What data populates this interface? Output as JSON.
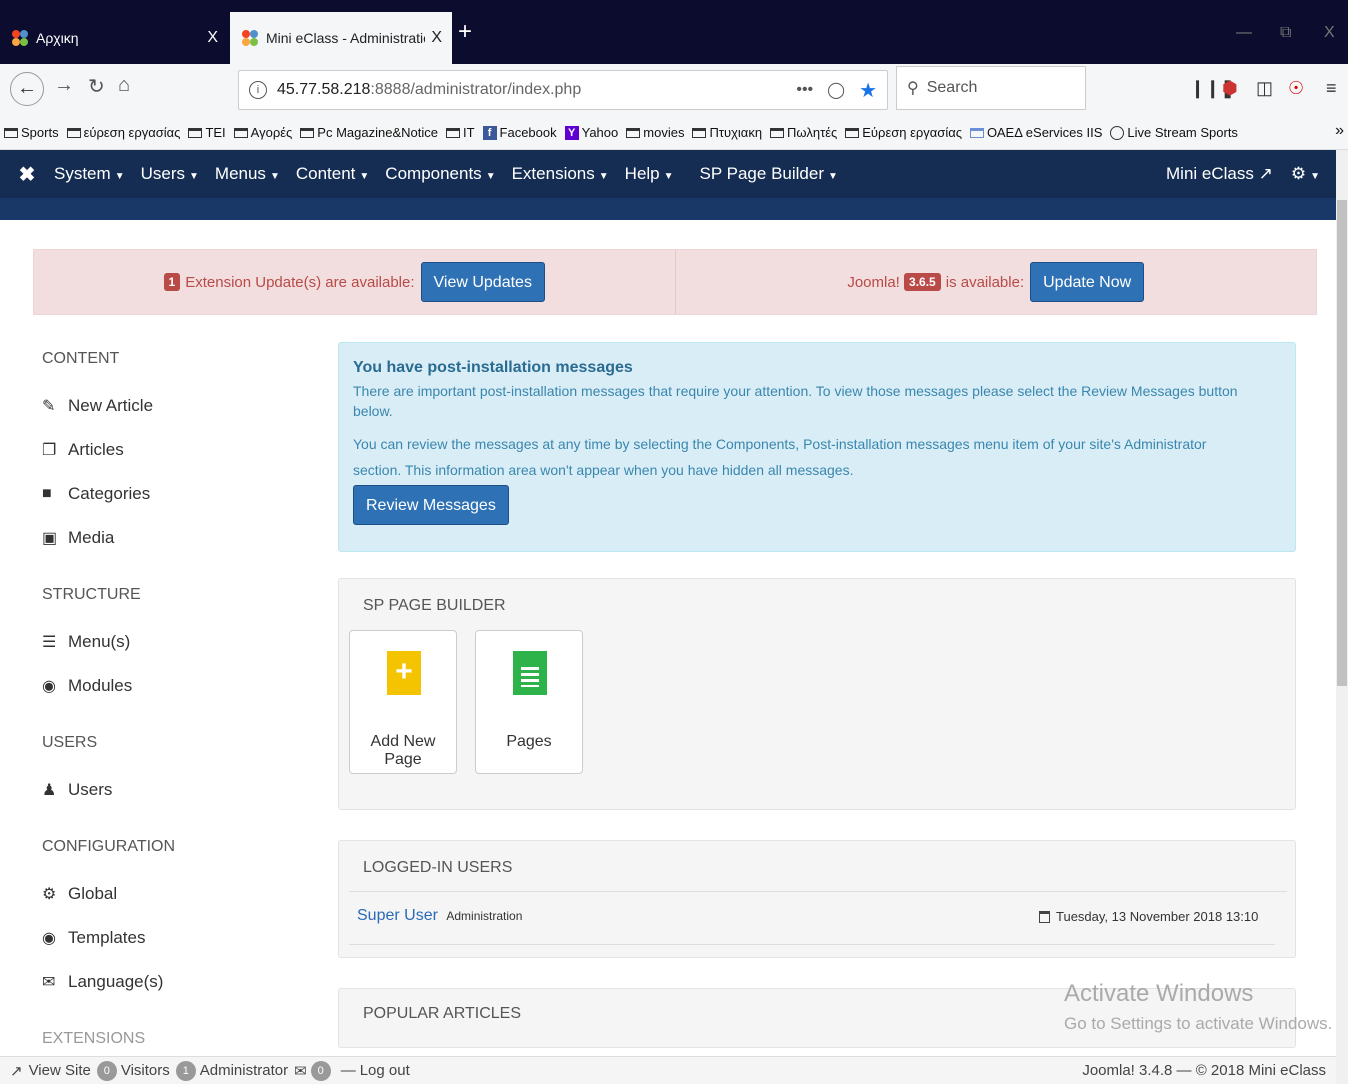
{
  "browser": {
    "tabs": [
      {
        "title": "Αρχικη",
        "close": "X"
      },
      {
        "title": "Mini eClass - Administration - ",
        "close": "X"
      }
    ],
    "new_tab": "+",
    "window_controls": {
      "minimize": "—",
      "restore": "⧉",
      "close": "X"
    },
    "url_host": "45.77.58.218",
    "url_rest": ":8888/administrator/index.php",
    "url_more": "•••",
    "search_placeholder": "Search",
    "bookmarks": [
      {
        "label": "Sports",
        "icon": "folder-icon"
      },
      {
        "label": "εύρεση εργασίας",
        "icon": "folder-icon"
      },
      {
        "label": "TEI",
        "icon": "folder-icon"
      },
      {
        "label": "Αγορές",
        "icon": "folder-icon"
      },
      {
        "label": "Pc Magazine&Notice",
        "icon": "folder-icon"
      },
      {
        "label": "IT",
        "icon": "folder-icon"
      },
      {
        "label": "Facebook",
        "icon": "facebook-icon"
      },
      {
        "label": "Yahoo",
        "icon": "yahoo-icon"
      },
      {
        "label": "movies",
        "icon": "folder-icon"
      },
      {
        "label": "Πτυχιακη",
        "icon": "folder-icon"
      },
      {
        "label": "Πωλητές",
        "icon": "folder-icon"
      },
      {
        "label": "Εύρεση εργασίας",
        "icon": "folder-icon"
      },
      {
        "label": "ΟΑΕΔ eServices IIS",
        "icon": "page-icon"
      },
      {
        "label": "Live Stream Sports",
        "icon": "globe-icon"
      }
    ],
    "bookmarks_more": "»"
  },
  "admin_menu": {
    "items": [
      "System",
      "Users",
      "Menus",
      "Content",
      "Components",
      "Extensions",
      "Help",
      "SP Page Builder"
    ],
    "site_name": "Mini eClass"
  },
  "alerts": {
    "ext_count": "1",
    "ext_text": "Extension Update(s) are available:",
    "ext_button": "View Updates",
    "joomla_prefix": "Joomla!",
    "joomla_version": "3.6.5",
    "joomla_suffix": "is available:",
    "joomla_button": "Update Now"
  },
  "sidebar": {
    "sections": [
      {
        "heading": "CONTENT",
        "items": [
          {
            "label": "New Article",
            "icon": "pencil-icon"
          },
          {
            "label": "Articles",
            "icon": "copy-icon"
          },
          {
            "label": "Categories",
            "icon": "folder-icon"
          },
          {
            "label": "Media",
            "icon": "image-icon"
          }
        ]
      },
      {
        "heading": "STRUCTURE",
        "items": [
          {
            "label": "Menu(s)",
            "icon": "list-icon"
          },
          {
            "label": "Modules",
            "icon": "cube-icon"
          }
        ]
      },
      {
        "heading": "USERS",
        "items": [
          {
            "label": "Users",
            "icon": "users-icon"
          }
        ]
      },
      {
        "heading": "CONFIGURATION",
        "items": [
          {
            "label": "Global",
            "icon": "gear-icon"
          },
          {
            "label": "Templates",
            "icon": "eye-icon"
          },
          {
            "label": "Language(s)",
            "icon": "comments-icon"
          }
        ]
      },
      {
        "heading": "EXTENSIONS",
        "items": []
      }
    ]
  },
  "postinstall": {
    "heading": "You have post-installation messages",
    "text1": "There are important post-installation messages that require your attention. To view those messages please select the Review Messages button below.",
    "text2": "You can review the messages at any time by selecting the Components, Post-installation messages menu item of your site's Administrator section. This information area won't appear when you have hidden all messages.",
    "button": "Review Messages"
  },
  "sp_page_builder": {
    "heading": "SP PAGE BUILDER",
    "cards": [
      {
        "label": "Add New Page",
        "icon": "add-page-icon"
      },
      {
        "label": "Pages",
        "icon": "pages-icon"
      }
    ]
  },
  "logged_in": {
    "heading": "LOGGED-IN USERS",
    "user": "Super User",
    "role": "Administration",
    "date": "Tuesday, 13 November 2018 13:10"
  },
  "popular": {
    "heading": "POPULAR ARTICLES"
  },
  "watermark": {
    "line1": "Activate Windows",
    "line2": "Go to Settings to activate Windows."
  },
  "statusbar": {
    "view_site": "View Site",
    "visitors_count": "0",
    "visitors_label": "Visitors",
    "admin_count": "1",
    "admin_label": "Administrator",
    "messages_count": "0",
    "logout": "Log out",
    "footer": "Joomla! 3.4.8 — © 2018 Mini eClass"
  }
}
